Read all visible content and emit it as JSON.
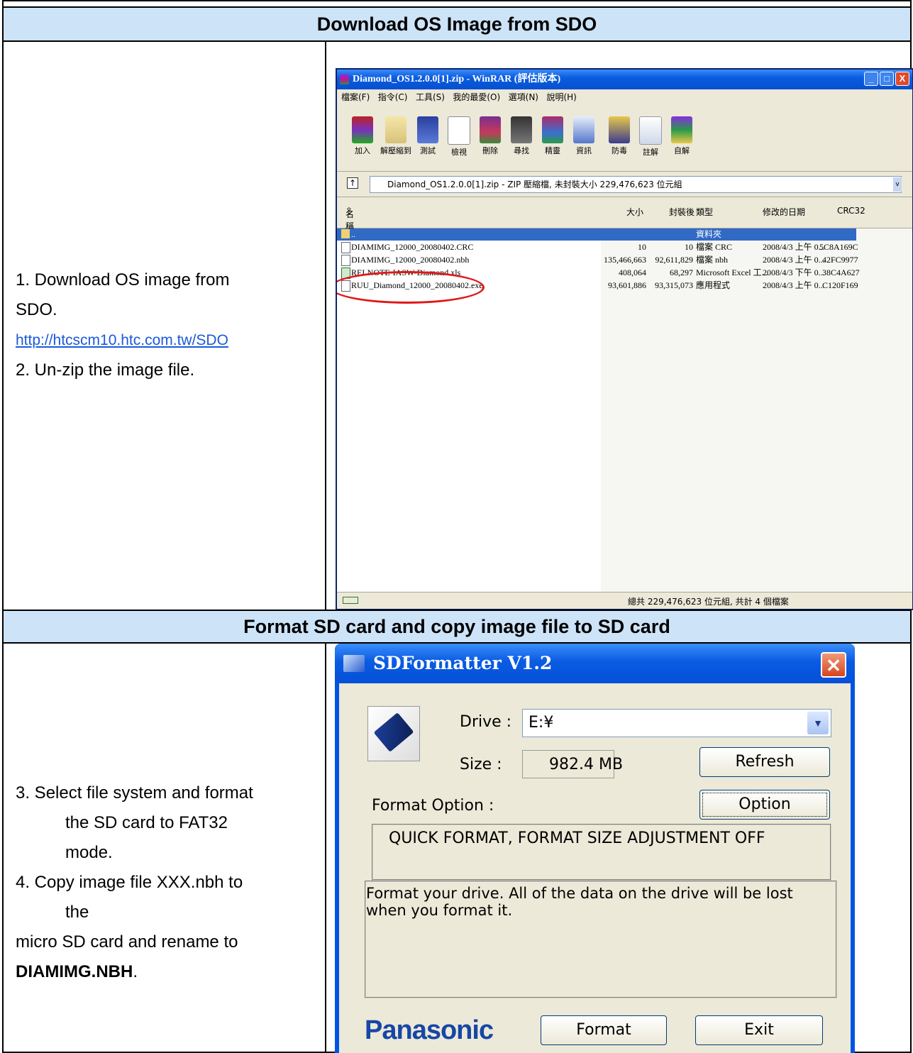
{
  "section1": {
    "header": "Download OS Image from SDO",
    "step1": "1.  Download OS image from",
    "step1b": "SDO.",
    "link": "http://htcscm10.htc.com.tw/SDO",
    "step2": "2.  Un-zip the image file."
  },
  "section2": {
    "header": "Format SD card and copy image file to SD card",
    "step3a": "3.  Select file system and format",
    "step3b": "the SD card to FAT32",
    "step3c": "mode.",
    "step4a": "4.  Copy image file XXX.nbh to",
    "step4b": "the",
    "step4c": "micro SD card and rename to",
    "step4d": "DIAMIMG.NBH",
    "step4e": "."
  },
  "winrar": {
    "title": "Diamond_OS1.2.0.0[1].zip - WinRAR (評估版本)",
    "menu": [
      "檔案(F)",
      "指令(C)",
      "工具(S)",
      "我的最愛(O)",
      "選項(N)",
      "說明(H)"
    ],
    "tools": [
      "加入",
      "解壓縮到",
      "測試",
      "檢視",
      "刪除",
      "尋找",
      "精靈",
      "資訊",
      "防毒",
      "註解",
      "自解"
    ],
    "address": "Diamond_OS1.2.0.0[1].zip - ZIP 壓縮檔, 未封裝大小 229,476,623 位元組",
    "columns": {
      "name": "名稱",
      "size": "大小",
      "packed": "封裝後",
      "type": "類型",
      "modified": "修改的日期",
      "crc": "CRC32"
    },
    "folder_row": {
      "name": "..",
      "type": "資料夾"
    },
    "files": [
      {
        "name": "DIAMIMG_12000_20080402.CRC",
        "size": "10",
        "packed": "10",
        "type": "檔案 CRC",
        "modified": "2008/4/3 上午 0...",
        "crc": "5C8A169C"
      },
      {
        "name": "DIAMIMG_12000_20080402.nbh",
        "size": "135,466,663",
        "packed": "92,611,829",
        "type": "檔案 nbh",
        "modified": "2008/4/3 上午 0...",
        "crc": "42FC9977"
      },
      {
        "name": "RELNOTE-IASW-Diamond.xls",
        "size": "408,064",
        "packed": "68,297",
        "type": "Microsoft Excel 工...",
        "modified": "2008/4/3 下午 0...",
        "crc": "38C4A627"
      },
      {
        "name": "RUU_Diamond_12000_20080402.exe",
        "size": "93,601,886",
        "packed": "93,315,073",
        "type": "應用程式",
        "modified": "2008/4/3 上午 0...",
        "crc": "C120F169"
      }
    ],
    "status": "總共 229,476,623 位元組, 共計 4 個檔案"
  },
  "sdformatter": {
    "title": "SDFormatter V1.2",
    "drive_label": "Drive :",
    "drive_value": "E:¥",
    "size_label": "Size  :",
    "size_value": "982.4  MB",
    "refresh": "Refresh",
    "format_option_label": "Format Option :",
    "option": "Option",
    "option_text": "QUICK FORMAT, FORMAT SIZE ADJUSTMENT OFF",
    "message": "Format your drive. All of the data on the drive will be lost when you format it.",
    "brand": "Panasonic",
    "format": "Format",
    "exit": "Exit"
  },
  "colors": {
    "header_bg": "#cde3f7",
    "link": "#1a5ad8",
    "panasonic": "#1646a6",
    "winrar_select": "#316ac5"
  }
}
